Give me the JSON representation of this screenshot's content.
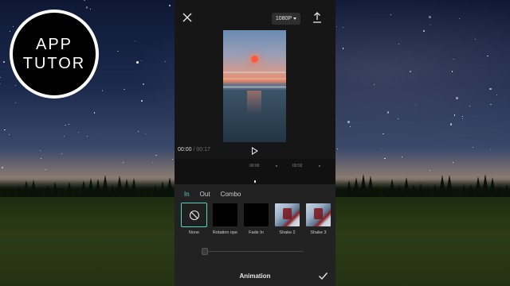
{
  "logo": {
    "line1": "APP",
    "line2": "TUTOR"
  },
  "toolbar": {
    "resolution": "1080P"
  },
  "player": {
    "current_time": "00:00",
    "separator": " / ",
    "duration": "00:17"
  },
  "timeline": {
    "ticks": [
      "00:00",
      "00:02"
    ]
  },
  "tabs": [
    {
      "label": "In",
      "active": true
    },
    {
      "label": "Out",
      "active": false
    },
    {
      "label": "Combo",
      "active": false
    }
  ],
  "animations": [
    {
      "label": "None",
      "selected": true
    },
    {
      "label": "Rotation ope",
      "selected": false
    },
    {
      "label": "Fade In",
      "selected": false
    },
    {
      "label": "Shake 2",
      "selected": false
    },
    {
      "label": "Shake 3",
      "selected": false
    }
  ],
  "bottom": {
    "title": "Animation"
  },
  "colors": {
    "accent": "#4fd6c5",
    "panel": "#222222",
    "app_bg": "#161616"
  },
  "icons": {
    "close": "close-icon",
    "export": "export-icon",
    "play": "play-icon",
    "none": "prohibit-icon",
    "confirm": "check-icon"
  }
}
